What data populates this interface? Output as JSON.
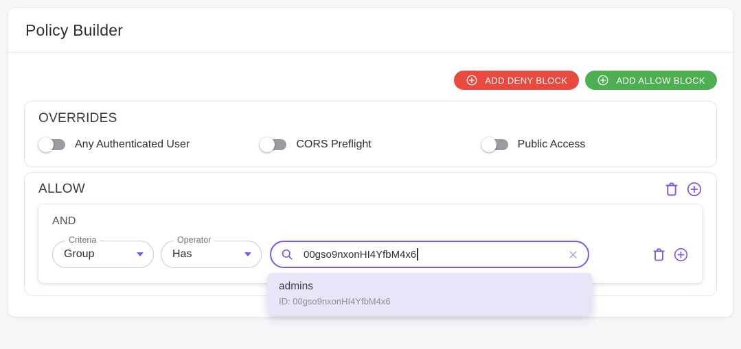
{
  "page": {
    "title": "Policy Builder"
  },
  "colors": {
    "accent_purple": "#7e52f4",
    "deny_red": "#ea4a3d",
    "allow_green": "#4caf50",
    "suggestion_lavender": "#e9e5f8"
  },
  "toolbar": {
    "add_deny": {
      "label": "ADD DENY BLOCK",
      "icon": "plus-circle"
    },
    "add_allow": {
      "label": "ADD ALLOW BLOCK",
      "icon": "plus-circle"
    }
  },
  "overrides": {
    "title": "OVERRIDES",
    "toggles": [
      {
        "label": "Any Authenticated User",
        "state": "off"
      },
      {
        "label": "CORS Preflight",
        "state": "off"
      },
      {
        "label": "Public Access",
        "state": "off"
      }
    ]
  },
  "allow_block": {
    "title": "ALLOW",
    "actions": [
      {
        "icon": "trash"
      },
      {
        "icon": "plus-circle"
      }
    ],
    "rule_group": {
      "conjunction": "AND",
      "row": {
        "criteria": {
          "label": "Criteria",
          "value": "Group"
        },
        "operator": {
          "label": "Operator",
          "value": "Has"
        },
        "search": {
          "value": "00gso9nxonHI4YfbM4x6",
          "icons": [
            "search",
            "clear"
          ]
        },
        "actions": [
          {
            "icon": "trash"
          },
          {
            "icon": "plus-circle"
          }
        ]
      }
    }
  },
  "suggestion_dropdown": {
    "items": [
      {
        "name": "admins",
        "id_text": "ID: 00gso9nxonHI4YfbM4x6"
      }
    ]
  }
}
